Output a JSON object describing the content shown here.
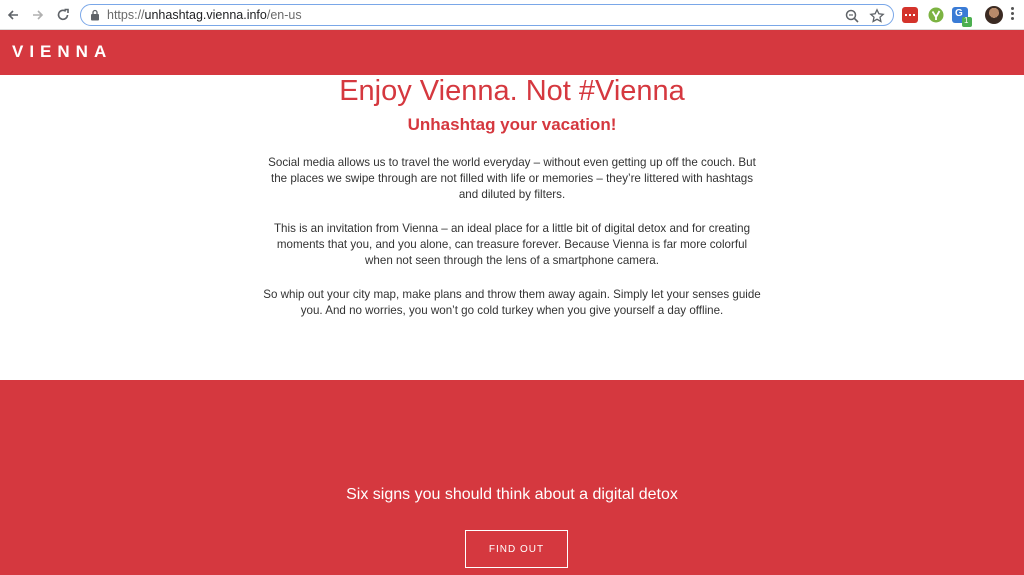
{
  "browser": {
    "url_scheme": "https://",
    "url_host": "unhashtag.vienna.info",
    "url_path": "/en-us",
    "icons": {
      "back": "back-arrow-icon",
      "forward": "forward-arrow-icon",
      "reload": "reload-icon",
      "lock": "lock-icon",
      "zoom": "zoom-icon",
      "bookmark": "star-icon",
      "extensions": [
        "lastpass-icon",
        "yoast-icon",
        "translate-icon"
      ],
      "profile": "avatar",
      "menu": "kebab-menu-icon"
    },
    "ext_blue_label": "G",
    "ext_badge_label": "1"
  },
  "header": {
    "logo": "VIENNA"
  },
  "main": {
    "headline": "Enjoy Vienna. Not #Vienna",
    "subheadline": "Unhashtag your vacation!",
    "paragraphs": [
      "Social media allows us to travel the world everyday – without even getting up off the couch. But the places we swipe through are not filled with life or memories – they’re littered with hashtags and diluted by filters.",
      "This is an invitation from Vienna – an ideal place for a little bit of digital detox and for creating moments that you, and you alone, can treasure forever. Because Vienna is far more colorful when not seen through the lens of a smartphone camera.",
      "So whip out your city map, make plans and throw them away again. Simply let your senses guide you. And no worries, you won’t go cold turkey when you give yourself a day offline."
    ]
  },
  "cta": {
    "title": "Six signs you should think about a digital detox",
    "button": "FIND OUT"
  },
  "colors": {
    "brand_red": "#d5383f",
    "omnibox_border": "#7aa7e8"
  }
}
